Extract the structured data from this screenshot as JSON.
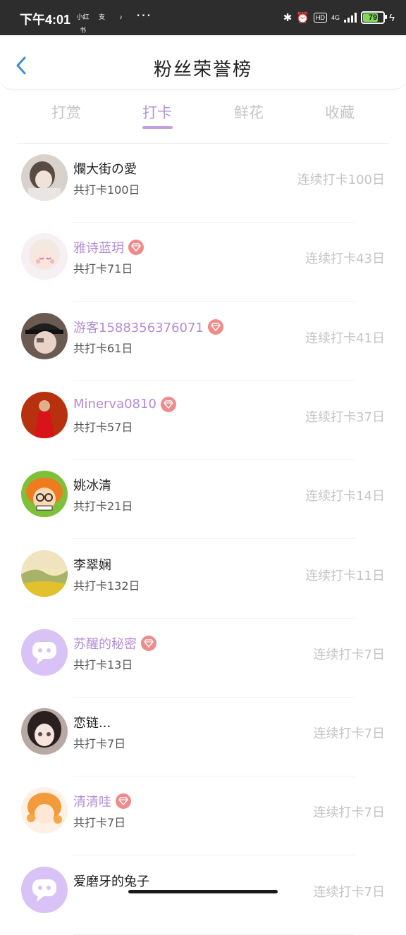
{
  "status_bar": {
    "time": "下午4:01",
    "app_icons": [
      {
        "name": "xiaohongshu-icon",
        "label": "小红书",
        "color": "#e8344a"
      },
      {
        "name": "alipay-icon",
        "label": "支",
        "color": "#1677ff"
      },
      {
        "name": "tiktok-icon",
        "label": "♪",
        "color": "#000000"
      }
    ],
    "more": "···",
    "hd": "HD",
    "network": "4G",
    "battery": "79",
    "battery_level": 0.79,
    "battery_color": "#7ed957"
  },
  "header": {
    "title": "粉丝荣誉榜"
  },
  "tabs": [
    {
      "label": "打赏",
      "active": false
    },
    {
      "label": "打卡",
      "active": true
    },
    {
      "label": "鲜花",
      "active": false
    },
    {
      "label": "收藏",
      "active": false
    }
  ],
  "colors": {
    "accent": "#c39fe6",
    "vip_name": "#b48cd6",
    "gem": "#ee8b8b",
    "muted": "#c4c4c4"
  },
  "rows": [
    {
      "name": "爛大街の愛",
      "vip": false,
      "total": "共打卡100日",
      "streak": "连续打卡100日",
      "avatar": "photo-girl-light"
    },
    {
      "name": "雅诗蓝玥",
      "vip": true,
      "total": "共打卡71日",
      "streak": "连续打卡43日",
      "avatar": "anime-white-hair"
    },
    {
      "name": "游客1588356376071",
      "vip": true,
      "total": "共打卡61日",
      "streak": "连续打卡41日",
      "avatar": "photo-cap-girl"
    },
    {
      "name": "Minerva0810",
      "vip": true,
      "total": "共打卡57日",
      "streak": "连续打卡37日",
      "avatar": "photo-red-dress"
    },
    {
      "name": "姚冰清",
      "vip": false,
      "total": "共打卡21日",
      "streak": "连续打卡14日",
      "avatar": "cartoon-orange-hair"
    },
    {
      "name": "李翠娴",
      "vip": false,
      "total": "共打卡132日",
      "streak": "连续打卡11日",
      "avatar": "landscape-painting"
    },
    {
      "name": "苏醒的秘密",
      "vip": true,
      "total": "共打卡13日",
      "streak": "连续打卡7日",
      "avatar": "default-chat-avatar"
    },
    {
      "name": "恋链...",
      "vip": false,
      "total": "共打卡7日",
      "streak": "连续打卡7日",
      "avatar": "anime-girl-dark"
    },
    {
      "name": "清清哇",
      "vip": true,
      "total": "共打卡7日",
      "streak": "连续打卡7日",
      "avatar": "anime-orange-girl"
    },
    {
      "name": "爱磨牙的兔子",
      "vip": false,
      "total": "",
      "streak": "连续打卡7日",
      "avatar": "default-chat-avatar"
    }
  ]
}
